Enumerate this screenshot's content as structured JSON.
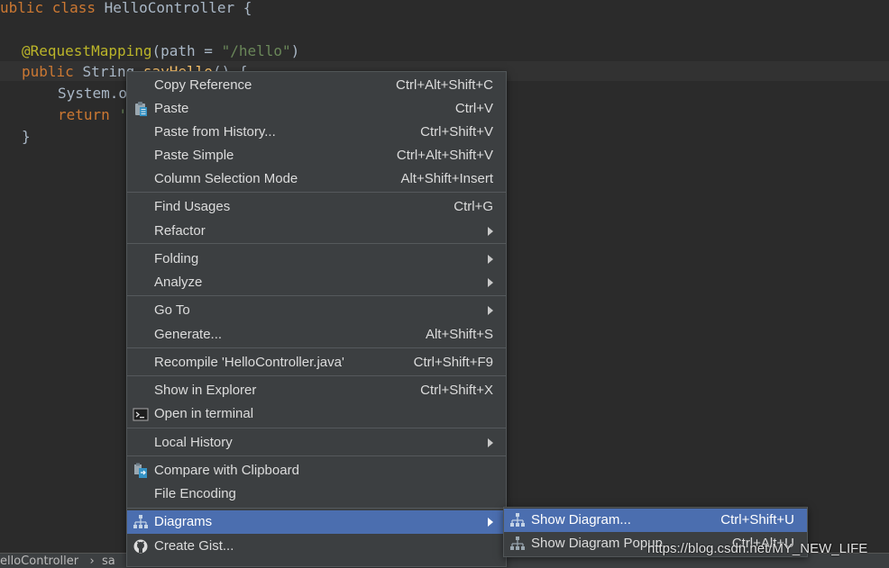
{
  "code": {
    "line1_prefix": "ublic class ",
    "line1_class": "HelloController",
    "line1_suffix": " {",
    "line3_annotation": "@RequestMapping",
    "line3_open": "(path = ",
    "line3_string": "\"/hello\"",
    "line3_close": ")",
    "line4_kw": "public ",
    "line4_type": "String ",
    "line4_method": "sayHello",
    "line4_rest": "() {",
    "line5": "System.o",
    "line6_kw": "return",
    "line6_rest": " '",
    "line7": "}"
  },
  "statusbar": {
    "text": "elloController   ›  sa"
  },
  "menu": {
    "items": [
      {
        "label": "Copy Reference",
        "shortcut": "Ctrl+Alt+Shift+C"
      },
      {
        "label": "Paste",
        "shortcut": "Ctrl+V"
      },
      {
        "label": "Paste from History...",
        "shortcut": "Ctrl+Shift+V"
      },
      {
        "label": "Paste Simple",
        "shortcut": "Ctrl+Alt+Shift+V"
      },
      {
        "label": "Column Selection Mode",
        "shortcut": "Alt+Shift+Insert"
      },
      {
        "label": "Find Usages",
        "shortcut": "Ctrl+G"
      },
      {
        "label": "Refactor",
        "shortcut": ""
      },
      {
        "label": "Folding",
        "shortcut": ""
      },
      {
        "label": "Analyze",
        "shortcut": ""
      },
      {
        "label": "Go To",
        "shortcut": ""
      },
      {
        "label": "Generate...",
        "shortcut": "Alt+Shift+S"
      },
      {
        "label": "Recompile 'HelloController.java'",
        "shortcut": "Ctrl+Shift+F9"
      },
      {
        "label": "Show in Explorer",
        "shortcut": "Ctrl+Shift+X"
      },
      {
        "label": "Open in terminal",
        "shortcut": ""
      },
      {
        "label": "Local History",
        "shortcut": ""
      },
      {
        "label": "Compare with Clipboard",
        "shortcut": ""
      },
      {
        "label": "File Encoding",
        "shortcut": ""
      },
      {
        "label": "Diagrams",
        "shortcut": ""
      },
      {
        "label": "Create Gist...",
        "shortcut": ""
      }
    ]
  },
  "submenu": {
    "items": [
      {
        "label": "Show Diagram...",
        "shortcut": "Ctrl+Shift+U"
      },
      {
        "label": "Show Diagram Popup...",
        "shortcut": "Ctrl+Alt+U"
      }
    ]
  },
  "watermark": "https://blog.csdn.net/MY_NEW_LIFE",
  "colors": {
    "background": "#2b2b2b",
    "menu_background": "#3c3f41",
    "selection": "#4b6eaf",
    "keyword": "#cc7832",
    "annotation": "#bbb529",
    "string": "#6a8759"
  },
  "icons": {
    "paste": "clipboard-icon",
    "terminal": "terminal-icon",
    "compare": "compare-icon",
    "diagrams": "diagram-icon",
    "gist": "github-icon"
  }
}
